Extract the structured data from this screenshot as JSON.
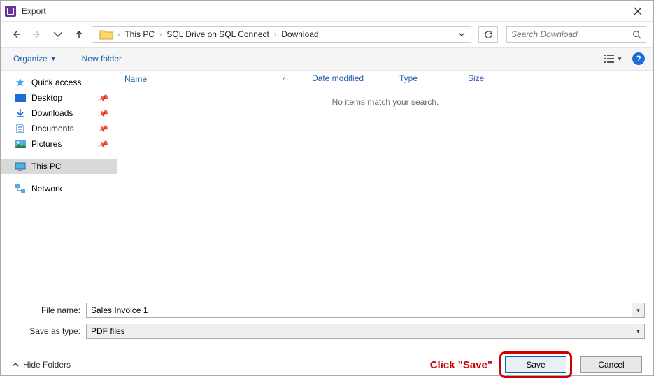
{
  "title": "Export",
  "breadcrumb": [
    "This PC",
    "SQL Drive on SQL Connect",
    "Download"
  ],
  "search_placeholder": "Search Download",
  "toolbar": {
    "organize": "Organize",
    "new_folder": "New folder"
  },
  "sidebar": {
    "quick_access": "Quick access",
    "items": [
      {
        "label": "Desktop"
      },
      {
        "label": "Downloads"
      },
      {
        "label": "Documents"
      },
      {
        "label": "Pictures"
      }
    ],
    "this_pc": "This PC",
    "network": "Network"
  },
  "columns": {
    "name": "Name",
    "date": "Date modified",
    "type": "Type",
    "size": "Size"
  },
  "empty_msg": "No items match your search.",
  "form": {
    "filename_label": "File name:",
    "filename_value": "Sales Invoice 1",
    "type_label": "Save as type:",
    "type_value": "PDF files"
  },
  "footer": {
    "hide_folders": "Hide Folders",
    "save": "Save",
    "cancel": "Cancel"
  },
  "annotation": "Click \"Save\""
}
